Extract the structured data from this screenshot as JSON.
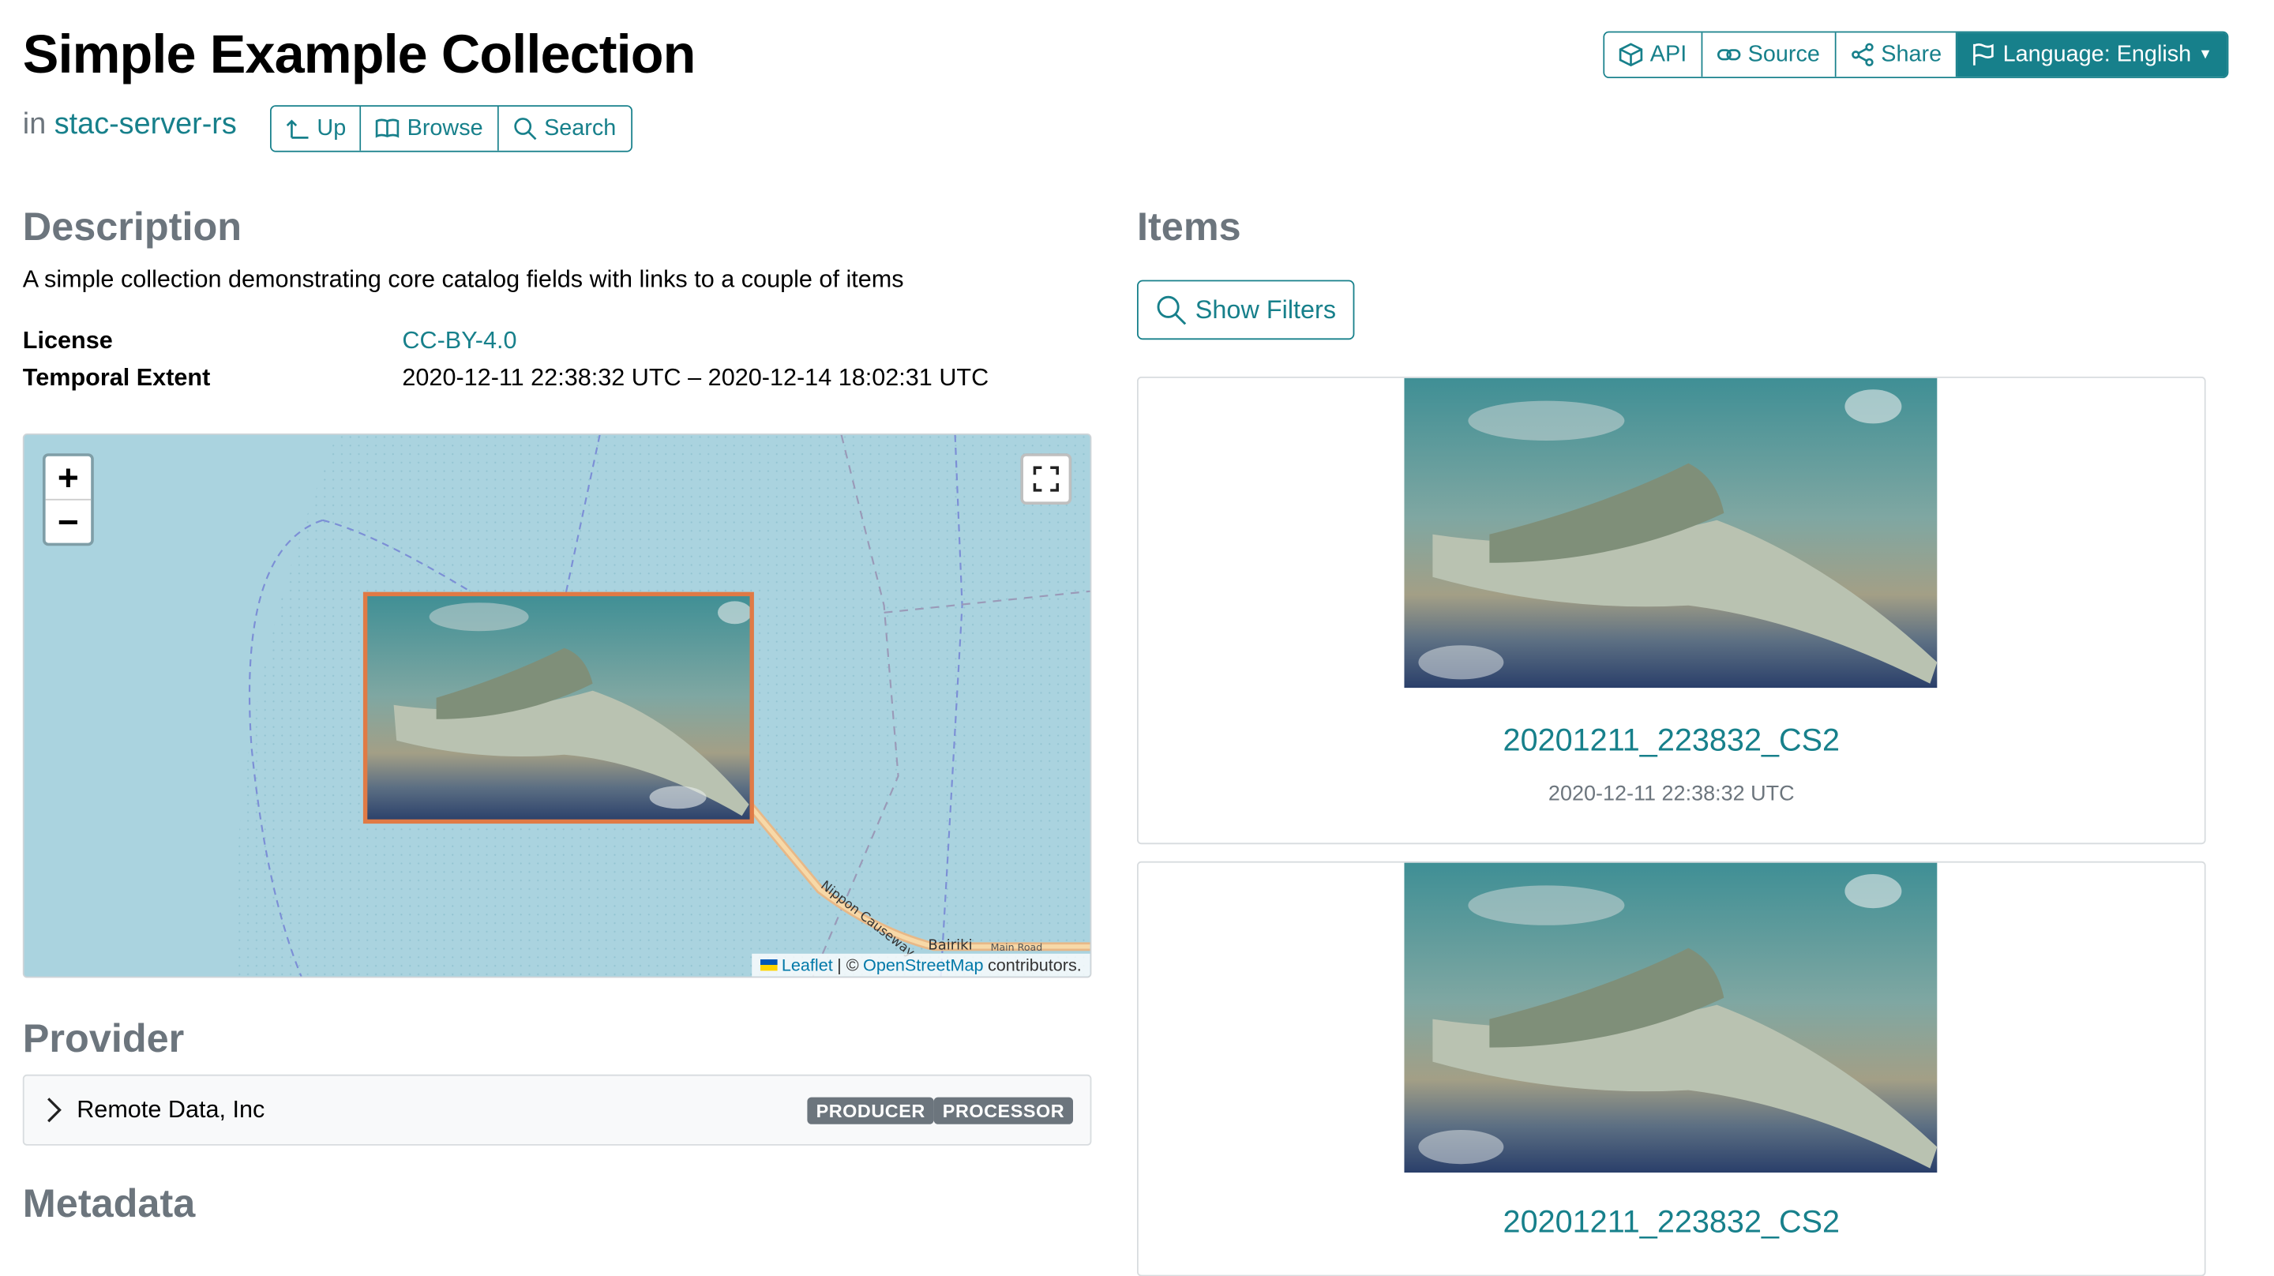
{
  "header": {
    "title": "Simple Example Collection",
    "in_prefix": "in",
    "parent_link": "stac-server-rs",
    "nav": {
      "up": "Up",
      "browse": "Browse",
      "search": "Search"
    },
    "toolbar": {
      "api": "API",
      "source": "Source",
      "share": "Share",
      "language": "Language: English"
    }
  },
  "description": {
    "heading": "Description",
    "text": "A simple collection demonstrating core catalog fields with links to a couple of items"
  },
  "properties": {
    "license_label": "License",
    "license_value": "CC-BY-4.0",
    "temporal_label": "Temporal Extent",
    "temporal_value": "2020-12-11 22:38:32 UTC – 2020-12-14 18:02:31 UTC"
  },
  "map": {
    "zoom_in": "+",
    "zoom_out": "−",
    "attribution_leaflet": "Leaflet",
    "attribution_sep": "| ©",
    "attribution_osm": "OpenStreetMap",
    "attribution_suffix": "contributors.",
    "label_causeway": "Nippon Causeway",
    "label_place": "Bairiki",
    "label_road": "Main Road",
    "bbox_color": "#e07a45"
  },
  "provider": {
    "heading": "Provider",
    "name": "Remote Data, Inc",
    "roles": [
      "PRODUCER",
      "PROCESSOR"
    ]
  },
  "metadata": {
    "heading": "Metadata"
  },
  "items": {
    "heading": "Items",
    "filter_button": "Show Filters",
    "list": [
      {
        "title": "20201211_223832_CS2",
        "date": "2020-12-11 22:38:32 UTC"
      },
      {
        "title": "20201211_223832_CS2",
        "date": ""
      }
    ]
  },
  "colors": {
    "accent": "#17808b",
    "muted": "#6c757d",
    "water": "#aad3df"
  }
}
